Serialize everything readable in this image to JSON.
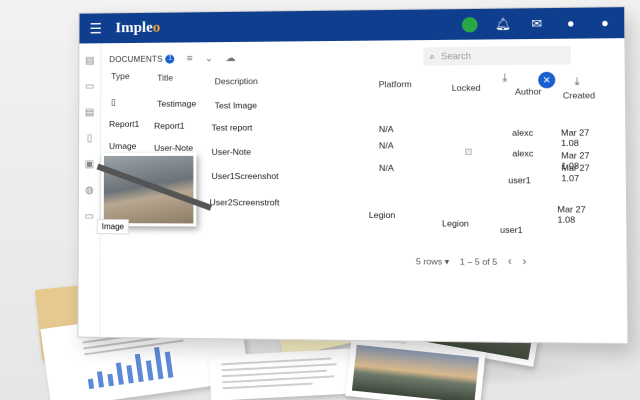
{
  "app": {
    "title": "Impleo",
    "title_main": "Imple",
    "title_accent": "o"
  },
  "toolbar": {
    "documents_label": "DOCUMENTS",
    "badge_count": "1",
    "search_placeholder": "Search"
  },
  "table": {
    "headers": [
      "Type",
      "Title",
      "Description",
      "Platform",
      "Locked",
      "Author",
      "Created"
    ],
    "rows": [
      {
        "type": "",
        "title": "Testimage",
        "description": "Test Image",
        "platform": "",
        "locked": "",
        "author": "",
        "created": ""
      },
      {
        "type": "Report1",
        "title": "Report1",
        "description": "Test report",
        "platform": "N/A",
        "locked": "",
        "author": "alexc",
        "created": "Mar 27\n1.08"
      },
      {
        "type": "Umage",
        "title": "User-Note",
        "description": "User-Note",
        "platform": "N/A",
        "locked": "lock",
        "author": "alexc",
        "created": "Mar 27\n1.08"
      },
      {
        "type": "",
        "title": "",
        "description": "User1Screenshot",
        "platform": "N/A",
        "locked": "",
        "author": "user1",
        "created": "Mar 27\n1.07"
      },
      {
        "type": "",
        "title": "",
        "description": "User2Screenstroft",
        "platform": "Legion",
        "locked": "Legion",
        "author": "user1",
        "created": "Mar 27\n1.08"
      }
    ]
  },
  "thumbnail_caption": "Image",
  "footer": {
    "rows_per_page": "5 rows",
    "range": "1 – 5 of 5"
  },
  "colors": {
    "topbar": "#0f3e8f",
    "accent": "#1a5fd0",
    "logo_accent": "#f2a033",
    "status_dot": "#28a745"
  },
  "icons": [
    "menu-icon",
    "bell-icon",
    "mail-icon",
    "user-icon",
    "account-icon",
    "filter-icon",
    "chevron-down-icon",
    "cloud-icon",
    "search-icon",
    "download-icon",
    "close-icon",
    "lock-icon"
  ]
}
